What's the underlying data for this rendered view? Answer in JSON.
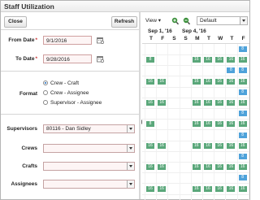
{
  "window": {
    "title": "Staff Utilization"
  },
  "toolbar": {
    "close_label": "Close",
    "refresh_label": "Refresh"
  },
  "form": {
    "from_date": {
      "label": "From Date",
      "required_mark": "*",
      "value": "9/1/2016"
    },
    "to_date": {
      "label": "To Date",
      "required_mark": "*",
      "value": "9/28/2016"
    },
    "format": {
      "label": "Format",
      "options": [
        "Crew - Craft",
        "Crew - Assignee",
        "Supervisor - Assignee"
      ],
      "selected": "Crew - Craft"
    },
    "supervisors": {
      "label": "Supervisors",
      "value": "80116 - Dan Sidley"
    },
    "crews": {
      "label": "Crews",
      "value": ""
    },
    "crafts": {
      "label": "Crafts",
      "value": ""
    },
    "assignees": {
      "label": "Assignees",
      "value": ""
    }
  },
  "schedule": {
    "view_label": "View",
    "view_dropdown_icon": "chevron-down-icon",
    "zoom_in_icon": "zoom-in-icon",
    "zoom_out_icon": "zoom-out-icon",
    "preset": "Default",
    "week_headers": [
      "Sep 1, '16",
      "Sep 4, '16"
    ],
    "day_headers": [
      "T",
      "F",
      "S",
      "S",
      "M",
      "T",
      "W",
      "T",
      "F"
    ],
    "rows": [
      {
        "cells": [
          null,
          null,
          null,
          null,
          null,
          null,
          null,
          null,
          "8"
        ]
      },
      {
        "cells": [
          "8",
          null,
          null,
          null,
          "16",
          "16",
          "16",
          "16",
          "16"
        ]
      },
      {
        "cells": [
          null,
          null,
          null,
          null,
          null,
          null,
          null,
          "8",
          "8"
        ]
      },
      {
        "cells": [
          "16",
          "16",
          null,
          null,
          "16",
          "16",
          "16",
          "16",
          "16"
        ]
      },
      {
        "cells": [
          null,
          null,
          null,
          null,
          null,
          null,
          null,
          null,
          "8"
        ]
      },
      {
        "cells": [
          "16",
          "16",
          null,
          null,
          "16",
          "16",
          "16",
          "16",
          "16"
        ]
      },
      {
        "cells": [
          null,
          null,
          null,
          null,
          null,
          null,
          null,
          null,
          "8"
        ]
      },
      {
        "cells": [
          "8",
          null,
          null,
          null,
          "16",
          "16",
          "16",
          "16",
          "16"
        ]
      },
      {
        "cells": [
          null,
          null,
          null,
          null,
          null,
          null,
          null,
          null,
          "8"
        ]
      },
      {
        "cells": [
          "16",
          "16",
          null,
          null,
          "16",
          "16",
          "16",
          "16",
          "16"
        ]
      },
      {
        "cells": [
          null,
          null,
          null,
          null,
          null,
          null,
          null,
          null,
          "8"
        ]
      },
      {
        "cells": [
          "16",
          "16",
          null,
          null,
          "16",
          "16",
          "16",
          "16",
          "16"
        ]
      },
      {
        "cells": [
          null,
          null,
          null,
          null,
          null,
          null,
          null,
          null,
          "8"
        ]
      },
      {
        "cells": [
          "16",
          "16",
          null,
          null,
          "16",
          "16",
          "16",
          "16",
          "16"
        ]
      }
    ]
  },
  "colors": {
    "work_chip": "#5aa77a",
    "partial_chip": "#4ea2da",
    "required": "#c33"
  }
}
